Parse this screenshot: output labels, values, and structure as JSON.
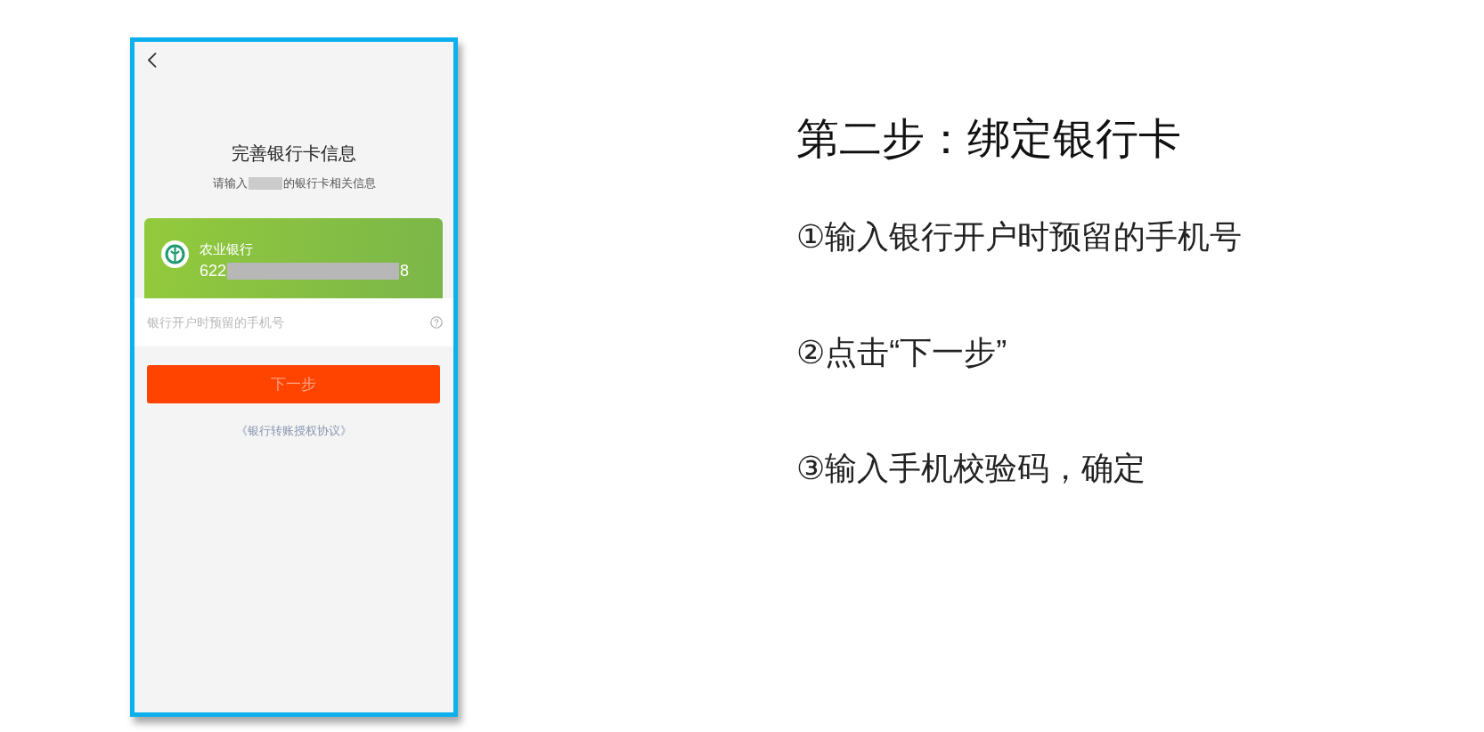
{
  "phone_screen": {
    "title": "完善银行卡信息",
    "subtitle": {
      "before": "请输入",
      "after": "的银行卡相关信息"
    },
    "bank_card": {
      "bank_name": "农业银行",
      "number_start": "622",
      "number_end": "8"
    },
    "phone_field": {
      "placeholder": "银行开户时预留的手机号"
    },
    "next_button": {
      "label": "下一步",
      "disabled": true
    },
    "agreement_link": "《银行转账授权协议》"
  },
  "instructions": {
    "heading": "第二步：绑定银行卡",
    "steps": [
      "①输入银行开户时预留的手机号",
      "②点击“下一步”",
      "③输入手机校验码，确定"
    ]
  }
}
